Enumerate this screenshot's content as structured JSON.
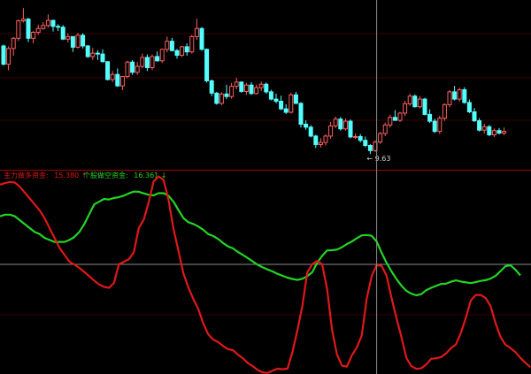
{
  "colors": {
    "background": "#000000",
    "candle_up": "#ff5f5f",
    "candle_down": "#54ffff",
    "grid_line": "#5a0000",
    "separator": "#a50000",
    "crosshair": "#9a9a9a",
    "series_main": "#e01818",
    "series_retail": "#24d424",
    "low_label": "#cfcfcf"
  },
  "price_panel": {
    "low_marker_text": "← 9.63"
  },
  "indicator_panel": {
    "legend": [
      {
        "label": "主力做多资金:",
        "value": "15.380",
        "arrow": "↑",
        "color": "#e01818"
      },
      {
        "label": "个股做空资金:",
        "value": "16.361",
        "arrow": "↓",
        "color": "#24d424"
      }
    ]
  },
  "chart_data": [
    {
      "type": "candlestick",
      "candles": [
        [
          12.17,
          12.2,
          11.71,
          11.74
        ],
        [
          11.74,
          12.16,
          11.6,
          12.11
        ],
        [
          12.11,
          12.38,
          11.94,
          12.35
        ],
        [
          12.35,
          12.79,
          12.29,
          12.76
        ],
        [
          12.76,
          13.06,
          12.72,
          12.8
        ],
        [
          12.8,
          12.83,
          12.26,
          12.35
        ],
        [
          12.35,
          12.52,
          12.23,
          12.49
        ],
        [
          12.49,
          12.67,
          12.43,
          12.58
        ],
        [
          12.58,
          12.73,
          12.55,
          12.65
        ],
        [
          12.65,
          12.91,
          12.6,
          12.77
        ],
        [
          12.77,
          12.79,
          12.51,
          12.63
        ],
        [
          12.63,
          12.68,
          12.52,
          12.61
        ],
        [
          12.61,
          12.66,
          12.31,
          12.33
        ],
        [
          12.33,
          12.47,
          12.25,
          12.39
        ],
        [
          12.39,
          12.39,
          12.03,
          12.14
        ],
        [
          12.14,
          12.48,
          12.11,
          12.42
        ],
        [
          12.42,
          12.47,
          12.11,
          12.17
        ],
        [
          12.17,
          12.19,
          11.89,
          11.92
        ],
        [
          11.92,
          12.12,
          11.84,
          12.0
        ],
        [
          12.0,
          12.07,
          11.84,
          11.98
        ],
        [
          11.98,
          12.09,
          11.78,
          11.8
        ],
        [
          11.8,
          11.81,
          11.36,
          11.38
        ],
        [
          11.38,
          11.58,
          11.32,
          11.5
        ],
        [
          11.5,
          11.64,
          11.21,
          11.23
        ],
        [
          11.23,
          11.45,
          11.13,
          11.45
        ],
        [
          11.45,
          11.82,
          11.41,
          11.79
        ],
        [
          11.79,
          11.84,
          11.49,
          11.55
        ],
        [
          11.55,
          11.79,
          11.49,
          11.69
        ],
        [
          11.69,
          11.99,
          11.64,
          11.9
        ],
        [
          11.9,
          11.97,
          11.58,
          11.66
        ],
        [
          11.66,
          11.97,
          11.6,
          11.92
        ],
        [
          11.92,
          12.04,
          11.8,
          11.82
        ],
        [
          11.82,
          12.11,
          11.77,
          12.09
        ],
        [
          12.09,
          12.39,
          12.02,
          12.28
        ],
        [
          12.28,
          12.36,
          12.04,
          12.06
        ],
        [
          12.06,
          12.1,
          11.87,
          11.95
        ],
        [
          11.95,
          12.17,
          11.91,
          12.15
        ],
        [
          12.15,
          12.23,
          11.94,
          12.03
        ],
        [
          12.03,
          12.43,
          11.99,
          12.39
        ],
        [
          12.39,
          12.81,
          12.31,
          12.58
        ],
        [
          12.58,
          12.61,
          12.06,
          12.09
        ],
        [
          12.09,
          12.11,
          11.31,
          11.35
        ],
        [
          11.35,
          11.38,
          10.99,
          11.06
        ],
        [
          11.06,
          11.09,
          10.79,
          10.82
        ],
        [
          10.82,
          11.08,
          10.78,
          11.04
        ],
        [
          11.04,
          11.26,
          10.92,
          10.98
        ],
        [
          10.98,
          11.3,
          10.93,
          11.22
        ],
        [
          11.22,
          11.42,
          11.15,
          11.32
        ],
        [
          11.32,
          11.34,
          11.07,
          11.1
        ],
        [
          11.1,
          11.3,
          11.02,
          11.25
        ],
        [
          11.25,
          11.32,
          11.02,
          11.05
        ],
        [
          11.05,
          11.26,
          11.03,
          11.19
        ],
        [
          11.19,
          11.33,
          11.11,
          11.27
        ],
        [
          11.27,
          11.31,
          11.04,
          11.09
        ],
        [
          11.09,
          11.14,
          10.89,
          10.92
        ],
        [
          10.92,
          11.05,
          10.82,
          10.87
        ],
        [
          10.87,
          11.0,
          10.66,
          10.69
        ],
        [
          10.69,
          10.8,
          10.57,
          10.61
        ],
        [
          10.61,
          11.07,
          10.58,
          11.02
        ],
        [
          11.02,
          11.09,
          10.8,
          10.82
        ],
        [
          10.82,
          10.85,
          10.25,
          10.33
        ],
        [
          10.33,
          10.42,
          10.2,
          10.26
        ],
        [
          10.26,
          10.31,
          10.02,
          10.05
        ],
        [
          10.05,
          10.08,
          9.77,
          9.85
        ],
        [
          9.85,
          10.0,
          9.78,
          9.9
        ],
        [
          9.9,
          10.09,
          9.83,
          10.05
        ],
        [
          10.05,
          10.38,
          9.99,
          10.29
        ],
        [
          10.29,
          10.51,
          10.24,
          10.45
        ],
        [
          10.45,
          10.5,
          10.18,
          10.22
        ],
        [
          10.22,
          10.46,
          10.18,
          10.4
        ],
        [
          10.4,
          10.44,
          10.0,
          10.03
        ],
        [
          10.03,
          10.11,
          9.98,
          10.04
        ],
        [
          10.04,
          10.1,
          9.9,
          9.95
        ],
        [
          9.95,
          10.04,
          9.79,
          9.83
        ],
        [
          9.83,
          9.86,
          9.63,
          9.71
        ],
        [
          9.71,
          9.95,
          9.68,
          9.91
        ],
        [
          9.91,
          10.15,
          9.87,
          10.11
        ],
        [
          10.11,
          10.37,
          10.05,
          10.31
        ],
        [
          10.31,
          10.55,
          10.25,
          10.49
        ],
        [
          10.49,
          10.66,
          10.42,
          10.42
        ],
        [
          10.42,
          10.62,
          10.38,
          10.59
        ],
        [
          10.59,
          10.88,
          10.52,
          10.81
        ],
        [
          10.81,
          11.05,
          10.76,
          10.99
        ],
        [
          10.99,
          11.03,
          10.72,
          10.74
        ],
        [
          10.74,
          10.99,
          10.7,
          10.92
        ],
        [
          10.92,
          10.95,
          10.54,
          10.56
        ],
        [
          10.56,
          10.68,
          10.36,
          10.4
        ],
        [
          10.4,
          10.46,
          10.12,
          10.16
        ],
        [
          10.16,
          10.53,
          10.1,
          10.47
        ],
        [
          10.47,
          10.82,
          10.41,
          10.79
        ],
        [
          10.79,
          11.13,
          10.73,
          11.09
        ],
        [
          11.09,
          11.23,
          10.89,
          10.92
        ],
        [
          10.92,
          11.19,
          10.86,
          11.14
        ],
        [
          11.14,
          11.2,
          10.81,
          10.84
        ],
        [
          10.84,
          10.91,
          10.59,
          10.62
        ],
        [
          10.62,
          10.71,
          10.38,
          10.41
        ],
        [
          10.41,
          10.47,
          10.16,
          10.19
        ],
        [
          10.19,
          10.34,
          10.11,
          10.27
        ],
        [
          10.27,
          10.31,
          10.05,
          10.08
        ],
        [
          10.08,
          10.23,
          10.03,
          10.18
        ],
        [
          10.18,
          10.24,
          10.09,
          10.12
        ],
        [
          10.12,
          10.25,
          10.07,
          10.16
        ]
      ],
      "low_point": {
        "index": 74,
        "value": 9.63
      },
      "ylim": [
        9.3,
        13.25
      ],
      "crosshair_index": 76
    },
    {
      "type": "line",
      "series": [
        {
          "key": "main",
          "color": "#e01818",
          "values": [
            96.0,
            96.8,
            97.4,
            97.1,
            95.0,
            92.0,
            89.0,
            86.0,
            83.0,
            79.0,
            74.0,
            69.0,
            64.0,
            60.5,
            57.0,
            55.5,
            53.8,
            51.8,
            49.6,
            47.4,
            45.4,
            44.2,
            43.7,
            46.2,
            55.7,
            56.9,
            58.2,
            61.7,
            74.0,
            78.3,
            87.1,
            97.7,
            100.2,
            98.5,
            88.4,
            73.7,
            62.5,
            51.1,
            44.0,
            38.1,
            33.0,
            25.8,
            20.2,
            17.5,
            16.2,
            14.2,
            12.6,
            12.1,
            9.8,
            8.0,
            5.5,
            4.0,
            2.0,
            0.8,
            0.6,
            1.7,
            2.7,
            2.4,
            2.7,
            11.0,
            22.1,
            34.3,
            51.5,
            55.7,
            57.3,
            55.7,
            43.1,
            22.4,
            9.8,
            4.3,
            3.7,
            9.5,
            13.5,
            19.6,
            38.3,
            49.7,
            55.2,
            54.8,
            49.9,
            38.6,
            28.3,
            18.7,
            8.1,
            4.0,
            2.6,
            2.9,
            4.8,
            7.7,
            8.0,
            8.6,
            10.4,
            13.1,
            15.0,
            20.9,
            28.5,
            37.3,
            40.1,
            40.1,
            38.5,
            34.4,
            25.7,
            18.8,
            14.8,
            13.2,
            11.1,
            8.2,
            5.7,
            3.5
          ]
        },
        {
          "key": "retail",
          "color": "#24d424",
          "values": [
            80.0,
            80.8,
            80.8,
            80.0,
            78.0,
            76.0,
            74.0,
            72.0,
            71.0,
            69.0,
            68.0,
            67.0,
            67.0,
            67.0,
            68.0,
            69.5,
            72.0,
            76.0,
            81.0,
            86.0,
            87.4,
            88.8,
            88.5,
            89.3,
            89.7,
            90.5,
            91.6,
            92.5,
            92.4,
            91.6,
            90.9,
            90.6,
            91.7,
            91.7,
            90.4,
            87.4,
            83.2,
            79.1,
            77.0,
            76.1,
            74.8,
            73.2,
            71.0,
            70.0,
            68.5,
            66.4,
            64.7,
            63.7,
            61.9,
            60.4,
            58.8,
            57.1,
            55.4,
            54.1,
            53.0,
            52.0,
            50.8,
            49.8,
            48.9,
            48.2,
            47.7,
            48.3,
            49.6,
            51.6,
            56.4,
            59.9,
            62.7,
            62.8,
            63.1,
            64.3,
            65.9,
            67.2,
            68.9,
            70.3,
            70.5,
            70.1,
            67.2,
            61.5,
            56.4,
            52.0,
            48.1,
            44.8,
            42.2,
            40.7,
            39.9,
            40.5,
            42.5,
            43.7,
            44.7,
            45.7,
            45.8,
            46.8,
            47.5,
            46.9,
            46.5,
            46.1,
            46.6,
            47.2,
            47.6,
            48.4,
            49.8,
            52.2,
            54.7,
            55.1,
            52.9,
            50.0
          ]
        }
      ],
      "ylim": [
        0,
        100
      ]
    }
  ]
}
